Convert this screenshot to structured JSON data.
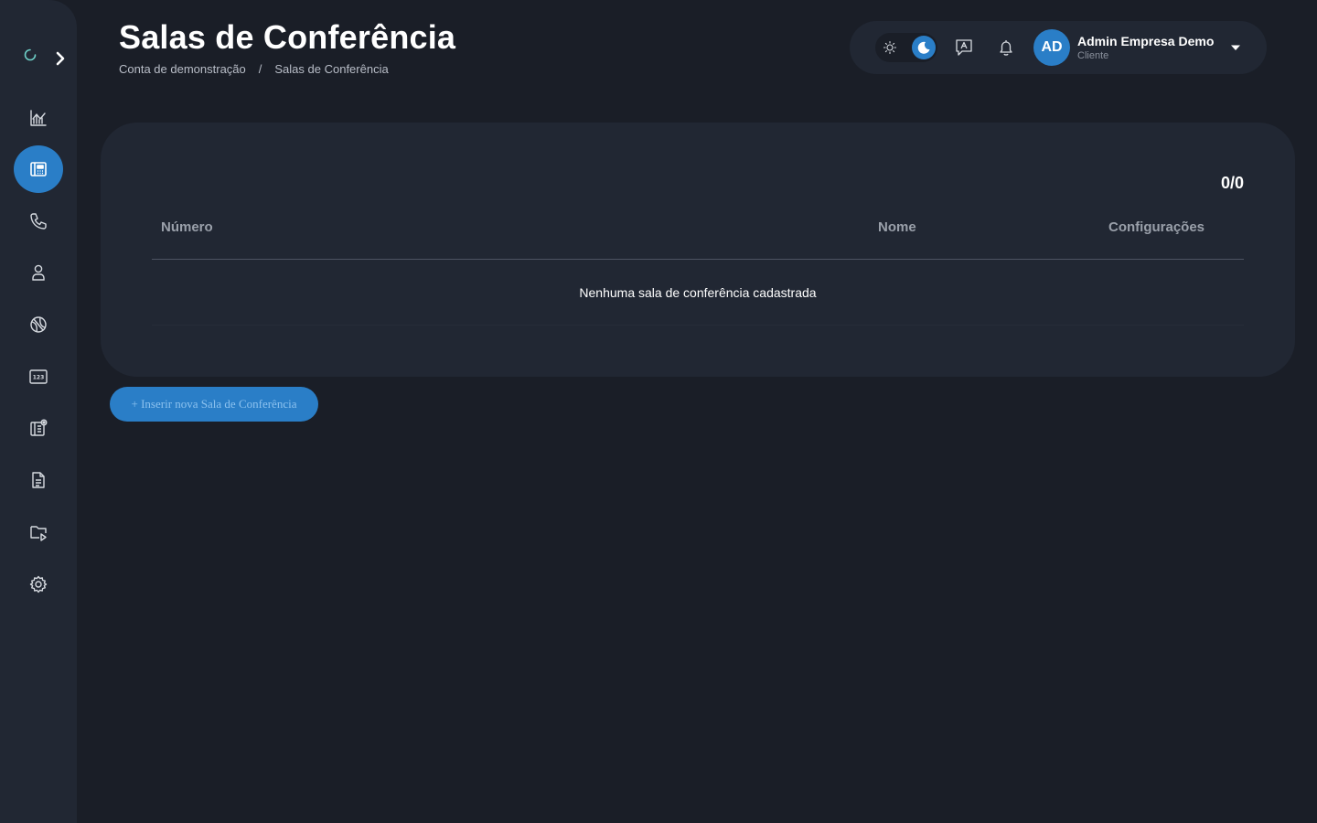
{
  "page": {
    "title": "Salas de Conferência",
    "breadcrumb": [
      "Conta de demonstração",
      "/",
      "Salas de Conferência"
    ]
  },
  "colors": {
    "accent": "#2a7ec7",
    "background": "#1a1e27",
    "surface": "#212733"
  },
  "sidebar": {
    "items": [
      {
        "name": "dashboard",
        "icon": "chart-line-icon"
      },
      {
        "name": "conference-rooms",
        "icon": "phone-book-icon",
        "active": true
      },
      {
        "name": "calls",
        "icon": "phone-icon"
      },
      {
        "name": "users",
        "icon": "user-icon"
      },
      {
        "name": "network",
        "icon": "globe-icon"
      },
      {
        "name": "numbers",
        "icon": "numeric-keypad-icon"
      },
      {
        "name": "extensions",
        "icon": "phone-book-settings-icon"
      },
      {
        "name": "reports",
        "icon": "document-icon"
      },
      {
        "name": "recordings",
        "icon": "folder-play-icon"
      },
      {
        "name": "settings",
        "icon": "gear-icon"
      }
    ]
  },
  "topbar": {
    "user_initials": "AD",
    "user_name": "Admin Empresa Demo",
    "user_role": "Cliente",
    "theme": "dark"
  },
  "table": {
    "pagination": "0/0",
    "columns": {
      "numero": "Número",
      "nome": "Nome",
      "configuracoes": "Configurações"
    },
    "empty_message": "Nenhuma sala de conferência cadastrada",
    "rows": []
  },
  "actions": {
    "add_label": "+ Inserir nova Sala de Conferência"
  }
}
